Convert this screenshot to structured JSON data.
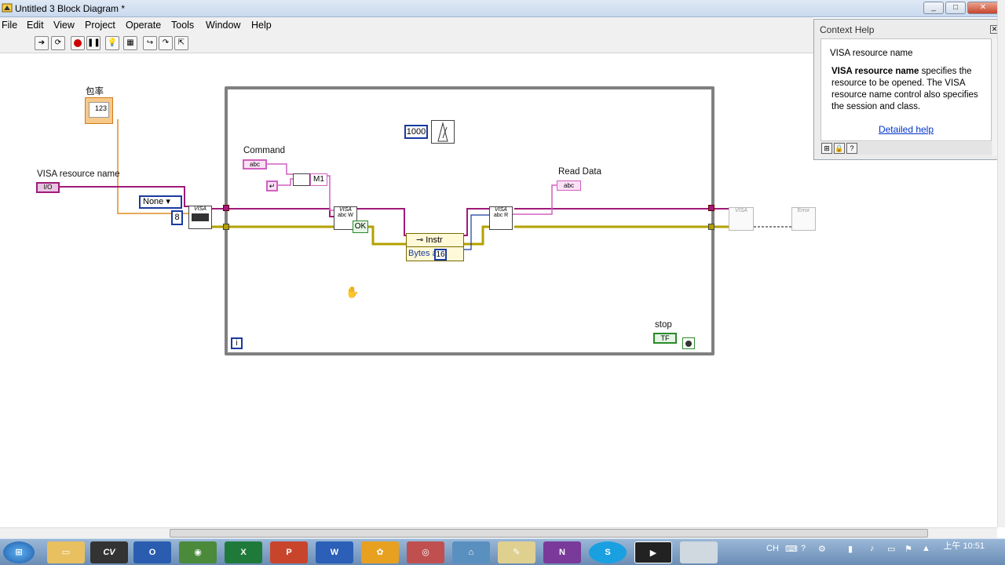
{
  "window": {
    "title": "Untitled 3 Block Diagram *"
  },
  "menu": [
    "File",
    "Edit",
    "View",
    "Project",
    "Operate",
    "Tools",
    "Window",
    "Help"
  ],
  "diagram": {
    "baud_label": "包率",
    "baud_value": "123",
    "visa_resource_label": "VISA resource name",
    "visa_resource_const": "I/O",
    "flow_control": "None",
    "data_bits": "8",
    "wait_const": "1000",
    "command_label": "Command",
    "command_const": "abc",
    "termination_label": "M1",
    "read_data_label": "Read Data",
    "read_data_ind": "abc",
    "property_node_class": "Instr",
    "property_node_prop": "Bytes a",
    "property_index": "16",
    "stop_label": "stop",
    "stop_value": "TF",
    "ok_label": "OK",
    "iteration_label": "i",
    "visa_serial_label": "VISA",
    "visa_close_label": "VISA",
    "error_label": "Error"
  },
  "context_help": {
    "title": "Context Help",
    "heading": "VISA resource name",
    "term": "VISA resource name",
    "description": "specifies the resource to be opened. The VISA resource name control also specifies the session and class.",
    "link": "Detailed help"
  },
  "taskbar": {
    "lang": "CH",
    "time": "上午 10:51",
    "apps": [
      "CV",
      "O",
      "Chrome",
      "X",
      "P",
      "W",
      "N",
      "S"
    ]
  },
  "colors": {
    "visa_wire": "#a01a7a",
    "error_wire": "#b3a000",
    "string_wire": "#d060c0",
    "numeric_wire": "#e08c20",
    "loop_border": "#808080"
  }
}
